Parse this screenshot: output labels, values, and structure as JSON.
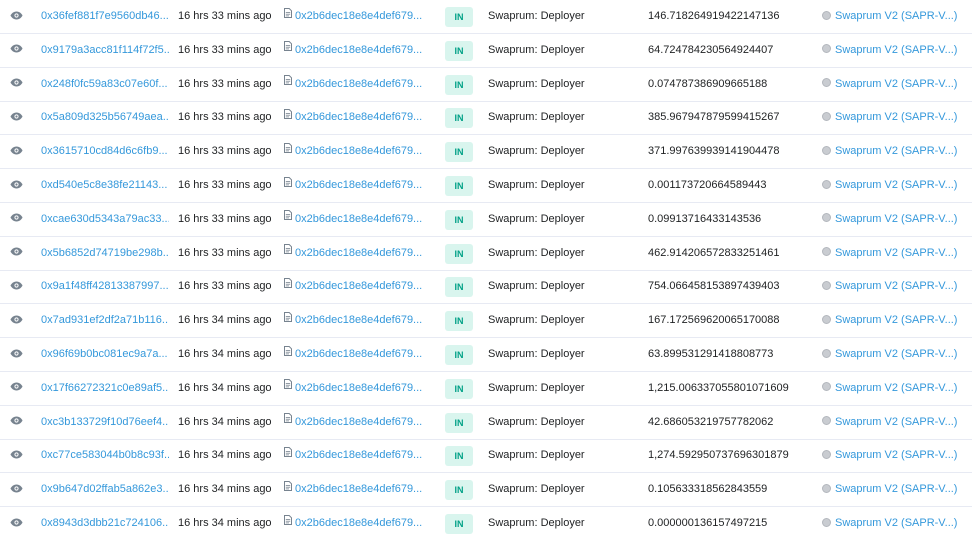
{
  "transfers": [
    {
      "hash": "0x36fef881f7e9560db46...",
      "age": "16 hrs 33 mins ago",
      "from": "0x2b6dec18e8e4def679...",
      "direction": "IN",
      "to": "Swaprum: Deployer",
      "value": "146.718264919422147136",
      "token": "Swaprum V2 (SAPR-V...)"
    },
    {
      "hash": "0x9179a3acc81f114f72f5...",
      "age": "16 hrs 33 mins ago",
      "from": "0x2b6dec18e8e4def679...",
      "direction": "IN",
      "to": "Swaprum: Deployer",
      "value": "64.724784230564924407",
      "token": "Swaprum V2 (SAPR-V...)"
    },
    {
      "hash": "0x248f0fc59a83c07e60f...",
      "age": "16 hrs 33 mins ago",
      "from": "0x2b6dec18e8e4def679...",
      "direction": "IN",
      "to": "Swaprum: Deployer",
      "value": "0.074787386909665188",
      "token": "Swaprum V2 (SAPR-V...)"
    },
    {
      "hash": "0x5a809d325b56749aea...",
      "age": "16 hrs 33 mins ago",
      "from": "0x2b6dec18e8e4def679...",
      "direction": "IN",
      "to": "Swaprum: Deployer",
      "value": "385.967947879599415267",
      "token": "Swaprum V2 (SAPR-V...)"
    },
    {
      "hash": "0x3615710cd84d6c6fb9...",
      "age": "16 hrs 33 mins ago",
      "from": "0x2b6dec18e8e4def679...",
      "direction": "IN",
      "to": "Swaprum: Deployer",
      "value": "371.997639939141904478",
      "token": "Swaprum V2 (SAPR-V...)"
    },
    {
      "hash": "0xd540e5c8e38fe21143...",
      "age": "16 hrs 33 mins ago",
      "from": "0x2b6dec18e8e4def679...",
      "direction": "IN",
      "to": "Swaprum: Deployer",
      "value": "0.001173720664589443",
      "token": "Swaprum V2 (SAPR-V...)"
    },
    {
      "hash": "0xcae630d5343a79ac33...",
      "age": "16 hrs 33 mins ago",
      "from": "0x2b6dec18e8e4def679...",
      "direction": "IN",
      "to": "Swaprum: Deployer",
      "value": "0.09913716433143536",
      "token": "Swaprum V2 (SAPR-V...)"
    },
    {
      "hash": "0x5b6852d74719be298b...",
      "age": "16 hrs 33 mins ago",
      "from": "0x2b6dec18e8e4def679...",
      "direction": "IN",
      "to": "Swaprum: Deployer",
      "value": "462.914206572833251461",
      "token": "Swaprum V2 (SAPR-V...)"
    },
    {
      "hash": "0x9a1f48ff42813387997...",
      "age": "16 hrs 33 mins ago",
      "from": "0x2b6dec18e8e4def679...",
      "direction": "IN",
      "to": "Swaprum: Deployer",
      "value": "754.066458153897439403",
      "token": "Swaprum V2 (SAPR-V...)"
    },
    {
      "hash": "0x7ad931ef2df2a71b116...",
      "age": "16 hrs 34 mins ago",
      "from": "0x2b6dec18e8e4def679...",
      "direction": "IN",
      "to": "Swaprum: Deployer",
      "value": "167.172569620065170088",
      "token": "Swaprum V2 (SAPR-V...)"
    },
    {
      "hash": "0x96f69b0bc081ec9a7a...",
      "age": "16 hrs 34 mins ago",
      "from": "0x2b6dec18e8e4def679...",
      "direction": "IN",
      "to": "Swaprum: Deployer",
      "value": "63.899531291418808773",
      "token": "Swaprum V2 (SAPR-V...)"
    },
    {
      "hash": "0x17f66272321c0e89af5...",
      "age": "16 hrs 34 mins ago",
      "from": "0x2b6dec18e8e4def679...",
      "direction": "IN",
      "to": "Swaprum: Deployer",
      "value": "1,215.006337055801071609",
      "token": "Swaprum V2 (SAPR-V...)"
    },
    {
      "hash": "0xc3b133729f10d76eef4...",
      "age": "16 hrs 34 mins ago",
      "from": "0x2b6dec18e8e4def679...",
      "direction": "IN",
      "to": "Swaprum: Deployer",
      "value": "42.686053219757782062",
      "token": "Swaprum V2 (SAPR-V...)"
    },
    {
      "hash": "0xc77ce583044b0b8c93f...",
      "age": "16 hrs 34 mins ago",
      "from": "0x2b6dec18e8e4def679...",
      "direction": "IN",
      "to": "Swaprum: Deployer",
      "value": "1,274.592950737696301879",
      "token": "Swaprum V2 (SAPR-V...)"
    },
    {
      "hash": "0x9b647d02ffab5a862e3...",
      "age": "16 hrs 34 mins ago",
      "from": "0x2b6dec18e8e4def679...",
      "direction": "IN",
      "to": "Swaprum: Deployer",
      "value": "0.105633318562843559",
      "token": "Swaprum V2 (SAPR-V...)"
    },
    {
      "hash": "0x8943d3dbb21c724106...",
      "age": "16 hrs 34 mins ago",
      "from": "0x2b6dec18e8e4def679...",
      "direction": "IN",
      "to": "Swaprum: Deployer",
      "value": "0.000000136157497215",
      "token": "Swaprum V2 (SAPR-V...)"
    }
  ],
  "icons": {
    "view": "eye-icon",
    "contract": "document-icon",
    "token": "token-icon"
  },
  "colors": {
    "link": "#3498db",
    "badge_text": "#00a186",
    "badge_bg": "#d9f5ee"
  }
}
